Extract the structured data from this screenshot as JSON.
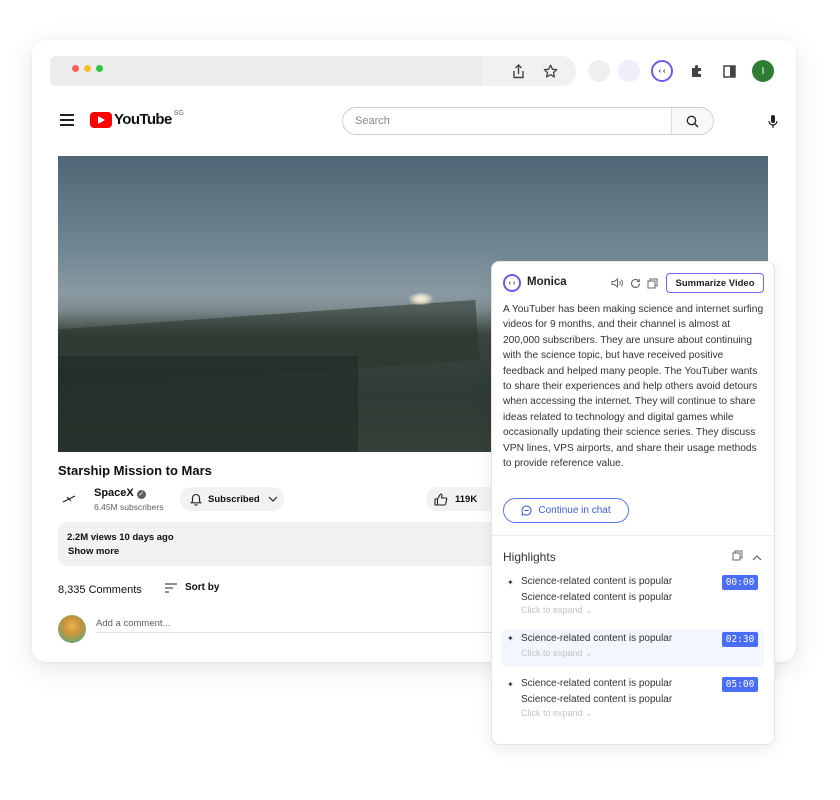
{
  "browser": {
    "toolbar_icons": [
      "share-icon",
      "star-icon",
      "monica-extension-icon",
      "puzzle-icon",
      "sidebar-icon"
    ],
    "profile_initial": "I",
    "profile_color": "#2e7d32"
  },
  "youtube": {
    "logo_text": "YouTube",
    "region": "SG",
    "search": {
      "placeholder": "Search"
    },
    "video": {
      "title": "Starship Mission to Mars",
      "channel_name": "SpaceX",
      "channel_subs": "6.45M subscribers",
      "subscribe_label": "Subscribed",
      "like_count": "119K"
    },
    "description": {
      "stats": "2.2M views  10 days ago",
      "show_more": "Show more"
    },
    "comments": {
      "count": "8,335 Comments",
      "sort_label": "Sort by",
      "add_placeholder": "Add a comment..."
    }
  },
  "monica": {
    "name": "Monica",
    "summarize_label": "Summarize Video",
    "summary": "A YouTuber has been making science and internet surfing videos for 9 months, and their channel is almost at 200,000 subscribers. They are unsure about continuing with the science topic, but have received positive feedback and helped many people. The YouTuber wants to share their experiences and help others avoid detours when accessing the internet. They will continue to share ideas related to technology and digital games while occasionally updating their science series. They discuss VPN lines, VPS airports, and share their usage methods to provide reference value.",
    "continue_label": "Continue in chat",
    "highlights_title": "Highlights",
    "highlights": [
      {
        "lines": [
          "Science-related content is popular",
          "Science-related content is popular"
        ],
        "expand": "Click to expand",
        "time": "00:00"
      },
      {
        "lines": [
          "Science-related content is popular"
        ],
        "expand": "Click to expand",
        "time": "02:30"
      },
      {
        "lines": [
          "Science-related content is popular",
          "Science-related content is popular"
        ],
        "expand": "Click to expand",
        "time": "05:00"
      }
    ],
    "accent_color": "#4a6cf7"
  }
}
